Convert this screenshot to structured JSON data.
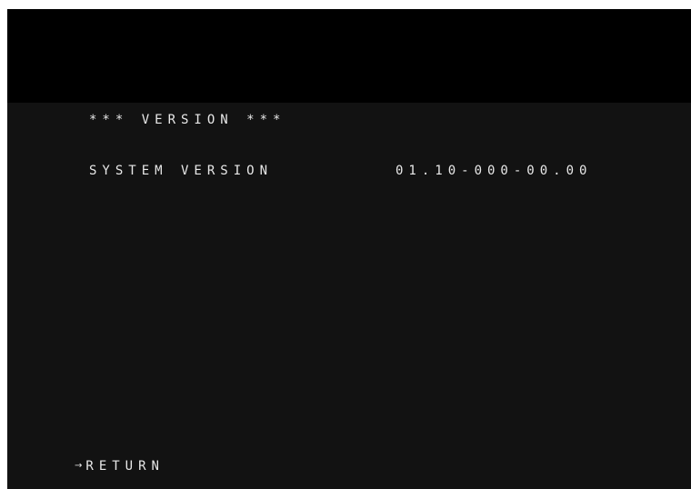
{
  "menu": {
    "title": "*** VERSION ***",
    "rows": [
      {
        "label": "SYSTEM VERSION",
        "value": "01.10-000-00.00"
      }
    ],
    "return_label": "RETURN",
    "return_arrow": "→"
  },
  "colors": {
    "background": "#121212",
    "top_band": "#000000",
    "text": "#e8e8e8"
  }
}
